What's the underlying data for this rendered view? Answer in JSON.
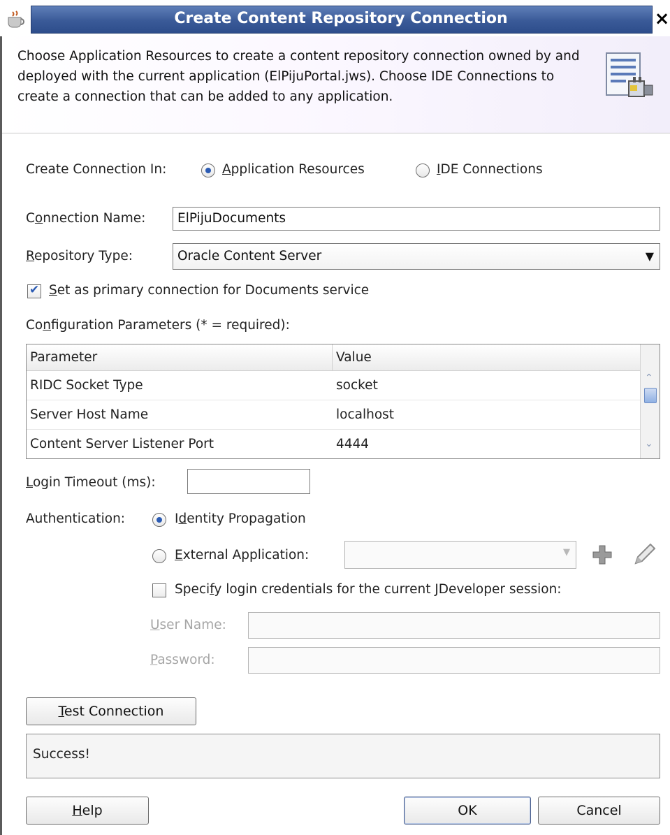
{
  "dialog": {
    "title": "Create Content Repository Connection",
    "close_glyph": "×",
    "header_text": "Choose Application Resources to create a content repository connection owned by and deployed with the current application (ElPijuPortal.jws). Choose IDE Connections to create a connection that can be added to any application."
  },
  "create_in": {
    "label": "Create Connection In:",
    "options": [
      {
        "label_mnemonic": "A",
        "label_rest": "pplication Resources",
        "selected": true
      },
      {
        "label_mnemonic": "I",
        "label_rest": "DE Connections",
        "selected": false
      }
    ]
  },
  "connection_name": {
    "label_pre": "C",
    "label_mnemonic": "o",
    "label_post": "nnection Name:",
    "value": "ElPijuDocuments"
  },
  "repository_type": {
    "label_mnemonic": "R",
    "label_post": "epository Type:",
    "value": "Oracle Content Server"
  },
  "primary": {
    "label_mnemonic": "S",
    "label_post": "et as primary connection for Documents service",
    "checked": true
  },
  "config": {
    "label_pre": "Co",
    "label_mnemonic": "n",
    "label_post": "figuration Parameters (* = required):",
    "columns": [
      "Parameter",
      "Value"
    ],
    "rows": [
      {
        "param": "RIDC Socket Type",
        "value": "socket"
      },
      {
        "param": "Server Host Name",
        "value": "localhost"
      },
      {
        "param": "Content Server Listener Port",
        "value": "4444"
      }
    ]
  },
  "login_timeout": {
    "label_mnemonic": "L",
    "label_post": "ogin Timeout (ms):",
    "value": ""
  },
  "authentication": {
    "label": "Authentication:",
    "identity": {
      "label_pre": "I",
      "label_mnemonic": "d",
      "label_post": "entity Propagation",
      "selected": true
    },
    "external": {
      "label_mnemonic": "E",
      "label_post": "xternal Application:",
      "selected": false,
      "value": ""
    },
    "specify": {
      "label_pre": "Speci",
      "label_mnemonic": "f",
      "label_post": "y login credentials for the current JDeveloper session:",
      "checked": false
    },
    "user_name": {
      "label_mnemonic": "U",
      "label_post": "ser Name:",
      "value": ""
    },
    "password": {
      "label_mnemonic": "P",
      "label_post": "assword:",
      "value": ""
    }
  },
  "test": {
    "button_mnemonic": "T",
    "button_post": "est Connection",
    "result": "Success!"
  },
  "buttons": {
    "help_mnemonic": "H",
    "help_post": "elp",
    "ok": "OK",
    "cancel": "Cancel"
  },
  "icons": {
    "app": "coffee-cup-icon",
    "header": "document-plug-icon",
    "add": "plus-icon",
    "edit": "pencil-icon"
  },
  "colors": {
    "title_bar": "#3a5a98",
    "accent": "#2b5bb3"
  }
}
